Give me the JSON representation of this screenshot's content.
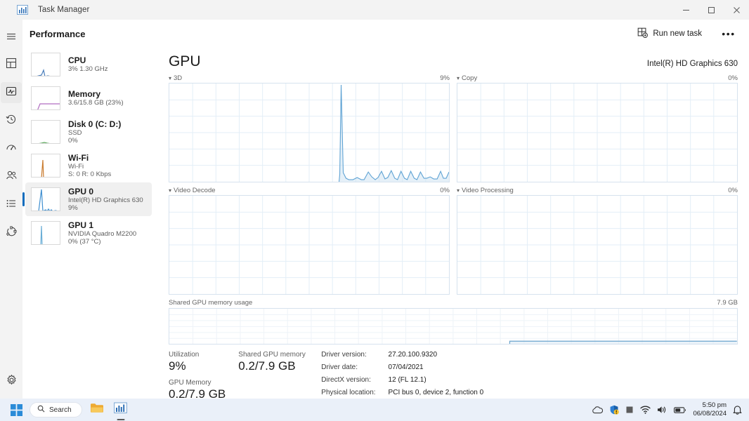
{
  "window": {
    "title": "Task Manager",
    "app_icon": "task-manager-icon",
    "controls": [
      {
        "name": "minimize",
        "glyph": "minimize-icon"
      },
      {
        "name": "maximize",
        "glyph": "maximize-icon"
      },
      {
        "name": "close",
        "glyph": "close-icon"
      }
    ]
  },
  "commandbar": {
    "page_title": "Performance",
    "run_new_task_label": "Run new task",
    "more_label": "•••"
  },
  "rail": {
    "items": [
      {
        "name": "hamburger-menu",
        "icon": "hamburger-icon",
        "selected": false
      },
      {
        "name": "processes",
        "icon": "processes-grid-icon",
        "selected": false
      },
      {
        "name": "performance",
        "icon": "performance-pulse-icon",
        "selected": true
      },
      {
        "name": "app-history",
        "icon": "clock-history-icon",
        "selected": false
      },
      {
        "name": "startup-apps",
        "icon": "startup-gauge-icon",
        "selected": false
      },
      {
        "name": "users",
        "icon": "users-icon",
        "selected": false
      },
      {
        "name": "details",
        "icon": "details-list-icon",
        "selected": false
      },
      {
        "name": "services",
        "icon": "services-cog-icon",
        "selected": false
      }
    ],
    "settings": {
      "name": "settings",
      "icon": "gear-icon"
    }
  },
  "sidebar": {
    "items": [
      {
        "key": "cpu",
        "name": "CPU",
        "lines": [
          "3%  1.30 GHz"
        ],
        "color": "#4a7ebb",
        "spark": "0,33 6,33 10,32 14,31 17,24 19,33 23,32 28,33 34,33 42,33"
      },
      {
        "key": "memory",
        "name": "Memory",
        "lines": [
          "3.6/15.8 GB (23%)"
        ],
        "color": "#b06cc0",
        "spark": "0,34 8,34 12,24 18,24 24,24 30,24 36,24 42,24"
      },
      {
        "key": "disk0",
        "name": "Disk 0 (C: D:)",
        "lines": [
          "SSD",
          "0%"
        ],
        "color": "#5ba85b",
        "spark": "0,33 8,33 14,32 18,31 22,32 28,33 34,33 42,33"
      },
      {
        "key": "wifi",
        "name": "Wi-Fi",
        "lines": [
          "Wi-Fi",
          "S: 0 R: 0 Kbps"
        ],
        "color": "#c97b2e",
        "spark": "0,34 14,34 16,8 17,34 24,34 42,34"
      },
      {
        "key": "gpu0",
        "name": "GPU 0",
        "lines": [
          "Intel(R) HD Graphics 630",
          "9%"
        ],
        "color": "#3f8fd0",
        "selected": true,
        "spark": "0,33 10,33 14,2 16,33 20,31 22,33 24,30 26,33 28,31 30,33 34,32 38,33 42,33"
      },
      {
        "key": "gpu1",
        "name": "GPU 1",
        "lines": [
          "NVIDIA Quadro M2200",
          "0%  (37 °C)"
        ],
        "color": "#6aaed6",
        "spark": "0,34 13,34 14,6 15,34 42,34"
      }
    ]
  },
  "main": {
    "heading": "GPU",
    "device_model": "Intel(R) HD Graphics 630",
    "graphs": [
      {
        "key": "g3d",
        "label": "3D",
        "value": "9%"
      },
      {
        "key": "copy",
        "label": "Copy",
        "value": "0%"
      },
      {
        "key": "video_decode",
        "label": "Video Decode",
        "value": "0%"
      },
      {
        "key": "video_processing",
        "label": "Video Processing",
        "value": "0%"
      }
    ],
    "shared_memory_graph": {
      "label": "Shared GPU memory usage",
      "max_label": "7.9 GB"
    },
    "stats": {
      "utilization_label": "Utilization",
      "utilization_value": "9%",
      "gpu_memory_label": "GPU Memory",
      "gpu_memory_value": "0.2/7.9 GB",
      "shared_memory_label": "Shared GPU memory",
      "shared_memory_value": "0.2/7.9 GB"
    },
    "info": [
      {
        "key": "Driver version:",
        "value": "27.20.100.9320"
      },
      {
        "key": "Driver date:",
        "value": "07/04/2021"
      },
      {
        "key": "DirectX version:",
        "value": "12 (FL 12.1)"
      },
      {
        "key": "Physical location:",
        "value": "PCI bus 0, device 2, function 0"
      }
    ]
  },
  "chart_data": [
    {
      "type": "area",
      "title": "3D",
      "ylabel": "Utilization",
      "ylim": [
        0,
        100
      ],
      "current_value_label": "9%",
      "grid": true,
      "points": [
        0,
        0,
        0,
        0,
        0,
        0,
        0,
        0,
        0,
        0,
        0,
        0,
        0,
        0,
        0,
        0,
        0,
        0,
        0,
        0,
        0,
        0,
        0,
        0,
        0,
        0,
        0,
        0,
        0,
        0,
        0,
        0,
        0,
        0,
        0,
        0,
        0,
        0,
        0,
        0,
        0,
        0,
        0,
        0,
        0,
        0,
        0,
        0,
        0,
        0,
        0,
        0,
        0,
        0,
        0,
        0,
        0,
        0,
        0,
        0,
        8,
        100,
        8,
        3,
        2,
        2,
        2,
        3,
        2,
        2,
        9,
        4,
        2,
        3,
        10,
        2,
        3,
        11,
        3,
        2,
        10,
        3,
        2,
        10,
        3,
        2,
        9,
        3,
        3,
        4,
        3,
        3,
        10,
        3,
        3,
        9
      ]
    },
    {
      "type": "area",
      "title": "Copy",
      "ylabel": "Utilization",
      "ylim": [
        0,
        100
      ],
      "current_value_label": "0%",
      "grid": true,
      "points": [
        0,
        0,
        0,
        0,
        0,
        0,
        0,
        0,
        0,
        0,
        0,
        0,
        0,
        0,
        0,
        0,
        0,
        0,
        0,
        0,
        0,
        0,
        0,
        0,
        0,
        0,
        0,
        0,
        0,
        0,
        0,
        0,
        0,
        0,
        0,
        0
      ]
    },
    {
      "type": "area",
      "title": "Video Decode",
      "ylabel": "Utilization",
      "ylim": [
        0,
        100
      ],
      "current_value_label": "0%",
      "grid": true,
      "points": [
        0,
        0,
        0,
        0,
        0,
        0,
        0,
        0,
        0,
        0,
        0,
        0,
        0,
        0,
        0,
        0,
        0,
        0,
        0,
        0,
        0,
        0,
        0,
        0,
        0,
        0,
        0,
        0,
        0,
        0,
        0,
        0,
        0,
        0,
        0,
        0
      ]
    },
    {
      "type": "area",
      "title": "Video Processing",
      "ylabel": "Utilization",
      "ylim": [
        0,
        100
      ],
      "current_value_label": "0%",
      "grid": true,
      "points": [
        0,
        0,
        0,
        0,
        0,
        0,
        0,
        0,
        0,
        0,
        0,
        0,
        0,
        0,
        0,
        0,
        0,
        0,
        0,
        0,
        0,
        0,
        0,
        0,
        0,
        0,
        0,
        0,
        0,
        0,
        0,
        0,
        0,
        0,
        0,
        0
      ]
    },
    {
      "type": "area",
      "title": "Shared GPU memory usage",
      "ylabel": "GB",
      "ylim": [
        0,
        7.9
      ],
      "ymax_label": "7.9 GB",
      "grid": true,
      "points": [
        null,
        null,
        null,
        null,
        null,
        null,
        null,
        null,
        null,
        null,
        null,
        null,
        null,
        null,
        null,
        null,
        null,
        null,
        null,
        null,
        null,
        null,
        null,
        null,
        null,
        null,
        null,
        null,
        null,
        null,
        0.2,
        0.2,
        0.2,
        0.2,
        0.2,
        0.2,
        0.2,
        0.2,
        0.2,
        0.2,
        0.2,
        0.2,
        0.2,
        0.2,
        0.2,
        0.2,
        0.2,
        0.2,
        0.2,
        0.2,
        0.2,
        0.2,
        0.2,
        0.2,
        0.2,
        0.2,
        0.2,
        0.2,
        0.2,
        0.2,
        0.2,
        0.2,
        0.2,
        0.2,
        0.2,
        0.2,
        0.2,
        0.2,
        0.2,
        0.2
      ]
    }
  ],
  "taskbar": {
    "start_label": "start-button",
    "search_placeholder": "Search",
    "apps": [
      {
        "name": "file-explorer",
        "icon": "folder-icon",
        "active": false
      },
      {
        "name": "task-manager",
        "icon": "task-manager-icon",
        "active": true
      }
    ],
    "tray": [
      {
        "name": "onedrive-icon"
      },
      {
        "name": "security-warning-icon"
      },
      {
        "name": "tray-square-icon"
      },
      {
        "name": "wifi-icon"
      },
      {
        "name": "volume-icon"
      },
      {
        "name": "battery-icon"
      }
    ],
    "time": "5:50 pm",
    "date": "06/08/2024",
    "notification_icon": "bell-icon"
  }
}
